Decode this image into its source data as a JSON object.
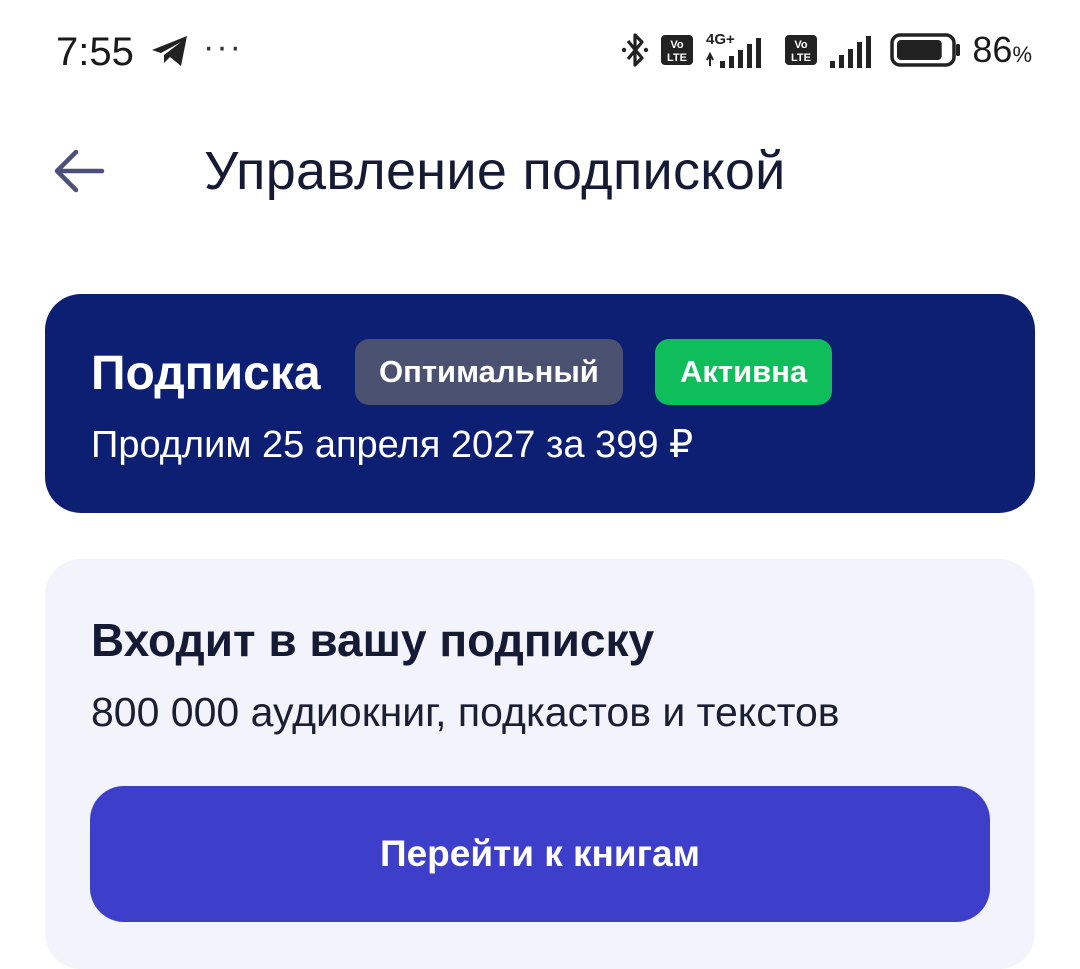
{
  "status_bar": {
    "time": "7:55",
    "network_label": "4G+",
    "volte_label": "Vo LTE",
    "battery_percent": "86",
    "battery_unit": "%",
    "battery_level": 0.86,
    "icons": [
      "telegram-icon",
      "more-dots-icon",
      "bluetooth-icon",
      "volte-icon",
      "signal-icon",
      "battery-icon"
    ]
  },
  "header": {
    "back_icon": "arrow-left-icon",
    "title": "Управление подпиской"
  },
  "subscription": {
    "title": "Подписка",
    "plan": "Оптимальный",
    "status": "Активна",
    "renewal": "Продлим 25 апреля 2027 за 399 ₽"
  },
  "included": {
    "title": "Входит в вашу подписку",
    "description": "800 000 аудиокниг, подкастов и текстов",
    "button_label": "Перейти к книгам"
  },
  "colors": {
    "card_dark": "#0c1f73",
    "badge_gray": "#4b5170",
    "badge_green": "#0fbd5a",
    "card_light": "#f2f3fb",
    "button": "#3d3ec9"
  }
}
